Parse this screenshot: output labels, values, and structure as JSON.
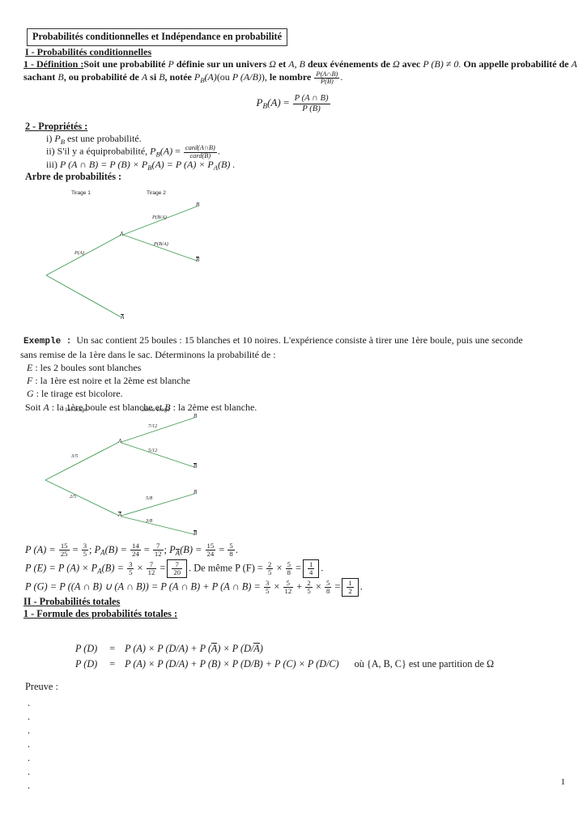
{
  "document": {
    "title": "Probabilités conditionnelles et Indépendance en probabilité",
    "page_number": "1"
  },
  "section_1": {
    "heading": "I - Probabilités conditionnelles",
    "definition_label": "1 - Définition :",
    "definition_part1": "Soit une probabilité ",
    "definition_P": "P",
    "definition_part2": " définie sur un univers ",
    "definition_omega": "Ω",
    "definition_part3": " et ",
    "definition_AB": "A, B",
    "definition_part4": " deux événements de ",
    "definition_part5": " avec ",
    "definition_cond": "P (B) ≠ 0.",
    "definition_part6": " On appelle probabilité de ",
    "definition_A": "A",
    "definition_sachant": " sachant ",
    "definition_B": "B",
    "definition_part7": ", ou probabilité de ",
    "definition_si": " si ",
    "definition_part8": ", notée ",
    "definition_PBA": "P",
    "definition_PBA_sub": "B",
    "definition_PBA_arg": "(A)",
    "definition_paren_ou": "(ou ",
    "definition_PAB": "P (A/B)",
    "definition_paren_close": "),",
    "definition_part9": " le nombre ",
    "definition_frac_num": "P(A∩B)",
    "definition_frac_den": "P(B)",
    "definition_period": ".",
    "display_equation": {
      "lhs_P": "P",
      "lhs_sub": "B",
      "lhs_arg": "(A)",
      "eq": "=",
      "num": "P (A ∩ B)",
      "den": "P (B)"
    }
  },
  "properties": {
    "heading": "2 - Propriétés :",
    "item_i_label": "i)",
    "item_i_P": "P",
    "item_i_sub": "B",
    "item_i_text": " est une probabilité.",
    "item_ii_label": "ii)",
    "item_ii_text": "S'il y a équiprobabilité, ",
    "item_ii_P": "P",
    "item_ii_sub": "B",
    "item_ii_arg": "(A)",
    "item_ii_eq": "=",
    "item_ii_num": "card(A∩B)",
    "item_ii_den": "card(B)",
    "item_ii_period": ".",
    "item_iii_label": "iii)",
    "item_iii_text": "P (A ∩ B) = P (B) × P",
    "item_iii_sub_b": "B",
    "item_iii_mid": "(A) = P (A) × P",
    "item_iii_sub_a": "A",
    "item_iii_end": "(B) ."
  },
  "tree_heading": "Arbre de probabilités :",
  "tree_1": {
    "col_headers": [
      "Tirage 1",
      "Tirage 2"
    ],
    "root_label": "",
    "node_A": "A",
    "node_Abar": "A",
    "leaf_B_top": "B",
    "leaf_Bbar": "B",
    "edge_root_A": "P(A)",
    "edge_A_B": "P(B/A)",
    "edge_A_Bbar": "P(B/A)",
    "line_color": "#3d9b53"
  },
  "example": {
    "label": "Exemple :",
    "text_line1": "Un sac contient 25 boules : 15 blanches et 10 noires. L'expérience consiste à tirer une 1ère boule, puis une seconde",
    "text_line2": "sans remise de la 1ère dans le sac. Déterminons la probabilité de :",
    "item_E_name": "E",
    "item_E_text": " : les 2 boules sont blanches",
    "item_F_name": "F",
    "item_F_text": " : la 1ère est noire et la 2ème est blanche",
    "item_G_name": "G",
    "item_G_text": " : le tirage est bicolore.",
    "soit_prefix": "Soit ",
    "soit_A": "A",
    "soit_mid": " : la 1ère boule est blanche et ",
    "soit_B": "B",
    "soit_end": " : la 2ème est blanche."
  },
  "tree_2": {
    "col_headers": [
      "1er tirage",
      "2ème tirage"
    ],
    "node_A": "A",
    "node_Abar": "A",
    "leaves": [
      "B",
      "B",
      "B",
      "B"
    ],
    "edge_root_A": "3/5",
    "edge_root_Abar": "2/5",
    "edge_A_B": "7/12",
    "edge_A_Bbar": "5/12",
    "edge_Abar_B": "5/8",
    "edge_Abar_Bbar": "3/8",
    "line_color": "#3d9b53"
  },
  "results": {
    "line1": {
      "p1": "P (A) =",
      "f1n": "15",
      "f1d": "25",
      "eq1": "=",
      "f2n": "3",
      "f2d": "5",
      "sep1": "; ",
      "p2": "P",
      "p2sub": "A",
      "p2arg": "(B) =",
      "f3n": "14",
      "f3d": "24",
      "eq2": "=",
      "f4n": "7",
      "f4d": "12",
      "sep2": "; ",
      "p3": "P",
      "p3sub": "A",
      "p3arg": "(B) =",
      "f5n": "15",
      "f5d": "24",
      "eq3": "=",
      "f6n": "5",
      "f6d": "8",
      "end": "."
    },
    "line2": {
      "p1": "P (E) = P (A) × P",
      "p1sub": "A",
      "p1arg": "(B) =",
      "f1n": "3",
      "f1d": "5",
      "times": "×",
      "f2n": "7",
      "f2d": "12",
      "eq": "=",
      "boxn": "7",
      "boxd": "20",
      "mid": ". De même P (F) =",
      "f3n": "2",
      "f3d": "5",
      "times2": "×",
      "f4n": "5",
      "f4d": "8",
      "eq2": "=",
      "box2n": "1",
      "box2d": "4",
      "end": "."
    },
    "line3": {
      "p1": "P (G) = P ((A ∩ B) ∪ (A ∩ B)) = P (A ∩ B) + P (A ∩ B) =",
      "f1n": "3",
      "f1d": "5",
      "times": "×",
      "f2n": "5",
      "f2d": "12",
      "plus": "+",
      "f3n": "2",
      "f3d": "5",
      "times2": "×",
      "f4n": "5",
      "f4d": "8",
      "eq": "=",
      "boxn": "1",
      "boxd": "2",
      "end": "."
    }
  },
  "section_2": {
    "heading": "II - Probabilités totales",
    "subheading": "1 - Formule des probabilités totales :",
    "formula_rows": [
      {
        "lhs": "P (D)",
        "eq": "=",
        "rhs_pre": "P (A) × P (D/A) + P (",
        "rhs_bar1": "A",
        "rhs_mid": ") × P (D/",
        "rhs_bar2": "A",
        "rhs_post": ")",
        "note": ""
      },
      {
        "lhs": "P (D)",
        "eq": "=",
        "rhs_pre": "P (A) × P (D/A) + P (B) × P (D/B) + P (C) × P (D/C)",
        "rhs_bar1": "",
        "rhs_mid": "",
        "rhs_bar2": "",
        "rhs_post": "",
        "note": "où {A, B, C} est une partition de Ω"
      }
    ],
    "preuve_label": "Preuve :",
    "dots": [
      ".",
      ".",
      ".",
      ".",
      ".",
      ".",
      "."
    ]
  }
}
